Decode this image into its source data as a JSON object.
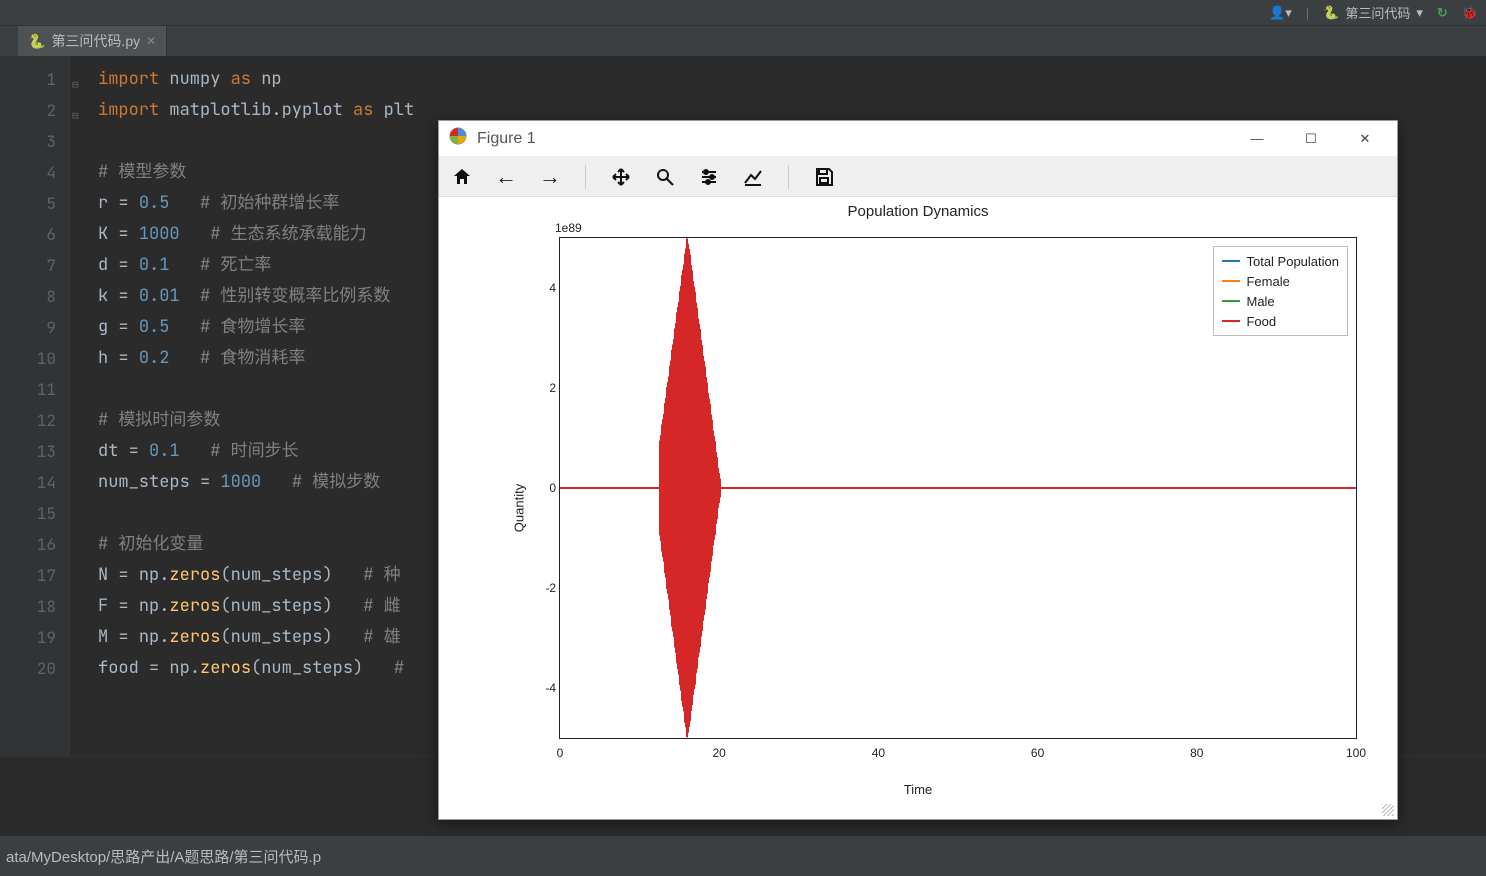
{
  "toolbar": {
    "run_config_label": "第三问代码",
    "user_icon_name": "user-icon",
    "run_icon_name": "run-icon",
    "debug_icon_name": "debug-icon"
  },
  "tab": {
    "filename": "第三问代码.py"
  },
  "gutter": [
    "1",
    "2",
    "3",
    "4",
    "5",
    "6",
    "7",
    "8",
    "9",
    "10",
    "11",
    "12",
    "13",
    "14",
    "15",
    "16",
    "17",
    "18",
    "19",
    "20"
  ],
  "code": {
    "l1": {
      "kw1": "import",
      "id1": "numpy",
      "kw2": "as",
      "id2": "np"
    },
    "l2": {
      "kw1": "import",
      "id1": "matplotlib.pyplot",
      "kw2": "as",
      "id2": "plt"
    },
    "c4": "# 模型参数",
    "l5": {
      "v": "r",
      "n": "0.5",
      "c": "# 初始种群增长率"
    },
    "l6": {
      "v": "K",
      "n": "1000",
      "c": "# 生态系统承载能力"
    },
    "l7": {
      "v": "d",
      "n": "0.1",
      "c": "# 死亡率"
    },
    "l8": {
      "v": "k",
      "n": "0.01",
      "c": "# 性别转变概率比例系数"
    },
    "l9": {
      "v": "g",
      "n": "0.5",
      "c": "# 食物增长率"
    },
    "l10": {
      "v": "h",
      "n": "0.2",
      "c": "# 食物消耗率"
    },
    "c12": "# 模拟时间参数",
    "l13": {
      "v": "dt",
      "n": "0.1",
      "c": "# 时间步长"
    },
    "l14": {
      "v": "num_steps",
      "n": "1000",
      "c": "# 模拟步数"
    },
    "c16": "# 初始化变量",
    "l17": {
      "v": "N",
      "fn": "np.zeros",
      "arg": "num_steps",
      "c": "# 种"
    },
    "l18": {
      "v": "F",
      "fn": "np.zeros",
      "arg": "num_steps",
      "c": "# 雌"
    },
    "l19": {
      "v": "M",
      "fn": "np.zeros",
      "arg": "num_steps",
      "c": "# 雄"
    },
    "l20": {
      "v": "food",
      "fn": "np.zeros",
      "arg": "num_steps",
      "c": "#"
    }
  },
  "status_path": "ata/MyDesktop/思路产出/A题思路/第三问代码.p",
  "figure": {
    "window_title": "Figure 1",
    "toolbar_tools": [
      "home",
      "back",
      "forward",
      "pan",
      "zoom",
      "configure",
      "plot-config",
      "save"
    ]
  },
  "chart_data": {
    "type": "line",
    "title": "Population Dynamics",
    "xlabel": "Time",
    "ylabel": "Quantity",
    "offset_text": "1e89",
    "xlim": [
      0,
      100
    ],
    "ylim": [
      -5,
      5
    ],
    "x_ticks": [
      0,
      20,
      40,
      60,
      80,
      100
    ],
    "y_ticks": [
      -4,
      -2,
      0,
      2,
      4
    ],
    "legend": [
      {
        "name": "Total Population",
        "color": "#1f77b4"
      },
      {
        "name": "Female",
        "color": "#ff7f0e"
      },
      {
        "name": "Male",
        "color": "#2ca02c"
      },
      {
        "name": "Food",
        "color": "#d62728"
      }
    ],
    "note": "Visually: all four series overlap near y=0 for most of x∈[0,100]; the red (Food) series shows a large oscillatory burst roughly between x≈13 and x≈20, amplitude spanning approximately [-5e89, +5e89].",
    "burst_center_x": 16,
    "burst_xrange": [
      12.5,
      20.5
    ],
    "burst_amplitude_y": 5
  }
}
